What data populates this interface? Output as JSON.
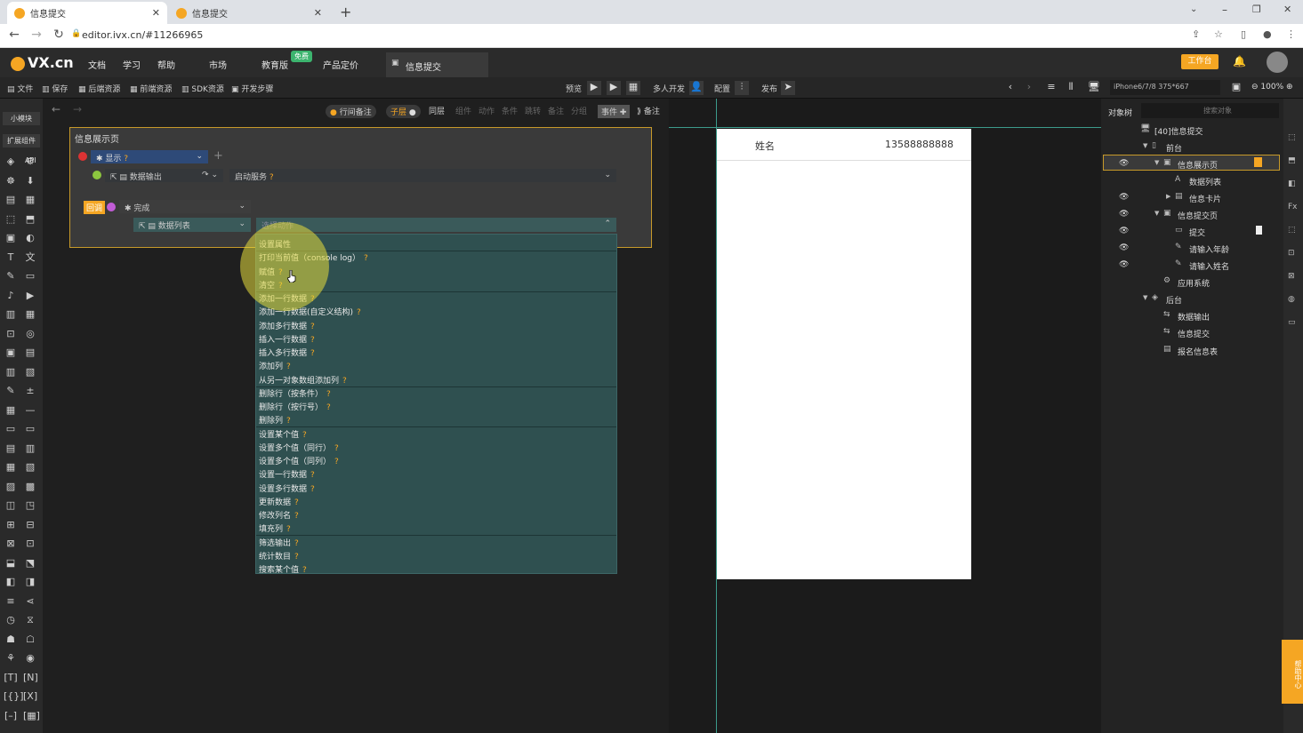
{
  "browser": {
    "tabs": [
      {
        "label": "信息提交"
      },
      {
        "label": "信息提交"
      }
    ],
    "url": "editor.ivx.cn/#11266965"
  },
  "header": {
    "logo": "VX.cn",
    "menu": [
      "文档",
      "学习",
      "帮助",
      "市场",
      "教育版",
      "产品定价"
    ],
    "free_badge": "免费",
    "current_tab": "信息提交",
    "work_button": "工作台"
  },
  "toolbar": {
    "left": [
      "文件",
      "保存",
      "后端资源",
      "前端资源",
      "SDK资源",
      "开发步骤"
    ],
    "preview": "预览",
    "multi": "多人开发",
    "config": "配置",
    "publish": "发布",
    "device": "iPhone6/7/8 375*667",
    "zoom": "100%"
  },
  "sidebar": {
    "tab1": "小模块",
    "tab2": "扩展组件",
    "api": "API"
  },
  "logicbar": {
    "comment": "行间备注",
    "sub": "子层",
    "sync": "同层",
    "dim": [
      "组件",
      "动作",
      "条件",
      "跳转",
      "备注",
      "分组"
    ],
    "event": "事件",
    "notes": "备注"
  },
  "logic": {
    "title": "信息展示页",
    "rows": [
      {
        "label": "显示",
        "extra": ""
      },
      {
        "label": "数据输出",
        "extra": "启动服务"
      },
      {
        "tag": "回调",
        "label": "完成"
      },
      {
        "label": "数据列表",
        "extra": "选择动作"
      }
    ]
  },
  "dropdown": {
    "items": [
      "设置属性",
      "打印当前值（console log）",
      "赋值",
      "清空",
      "添加一行数据",
      "添加一行数据(自定义结构)",
      "添加多行数据",
      "插入一行数据",
      "插入多行数据",
      "添加列",
      "从另一对象数组添加列",
      "删除行（按条件）",
      "删除行（按行号）",
      "删除列",
      "设置某个值",
      "设置多个值（同行）",
      "设置多个值（同列）",
      "设置一行数据",
      "设置多行数据",
      "更新数据",
      "修改列名",
      "填充列",
      "筛选输出",
      "统计数目",
      "搜索某个值"
    ],
    "no_q": [
      0
    ],
    "separators_after": [
      0,
      3,
      10,
      13,
      21
    ]
  },
  "phone": {
    "label": "姓名",
    "value": "13588888888"
  },
  "objects": {
    "title": "对象树",
    "search_placeholder": "搜索对象",
    "tree": [
      {
        "label": "[40]信息提交",
        "indent": 0,
        "arrow": "",
        "eye": false
      },
      {
        "label": "前台",
        "indent": 1,
        "arrow": "▼",
        "eye": false
      },
      {
        "label": "信息展示页",
        "indent": 2,
        "arrow": "▼",
        "eye": true
      },
      {
        "label": "数据列表",
        "indent": 3,
        "arrow": "",
        "eye": false
      },
      {
        "label": "信息卡片",
        "indent": 3,
        "arrow": "▶",
        "eye": true
      },
      {
        "label": "信息提交页",
        "indent": 2,
        "arrow": "▼",
        "eye": true
      },
      {
        "label": "提交",
        "indent": 3,
        "arrow": "",
        "eye": true
      },
      {
        "label": "请输入年龄",
        "indent": 3,
        "arrow": "",
        "eye": true
      },
      {
        "label": "请输入姓名",
        "indent": 3,
        "arrow": "",
        "eye": true
      },
      {
        "label": "应用系统",
        "indent": 2,
        "arrow": "",
        "eye": false
      },
      {
        "label": "后台",
        "indent": 1,
        "arrow": "▼",
        "eye": false
      },
      {
        "label": "数据输出",
        "indent": 2,
        "arrow": "",
        "eye": false
      },
      {
        "label": "信息提交",
        "indent": 2,
        "arrow": "",
        "eye": false
      },
      {
        "label": "报名信息表",
        "indent": 2,
        "arrow": "",
        "eye": false
      }
    ]
  },
  "help": "帮助中心",
  "colors": {
    "accent": "#f5a623",
    "dropdown": "#2f5050",
    "select": "#2e4a78"
  }
}
